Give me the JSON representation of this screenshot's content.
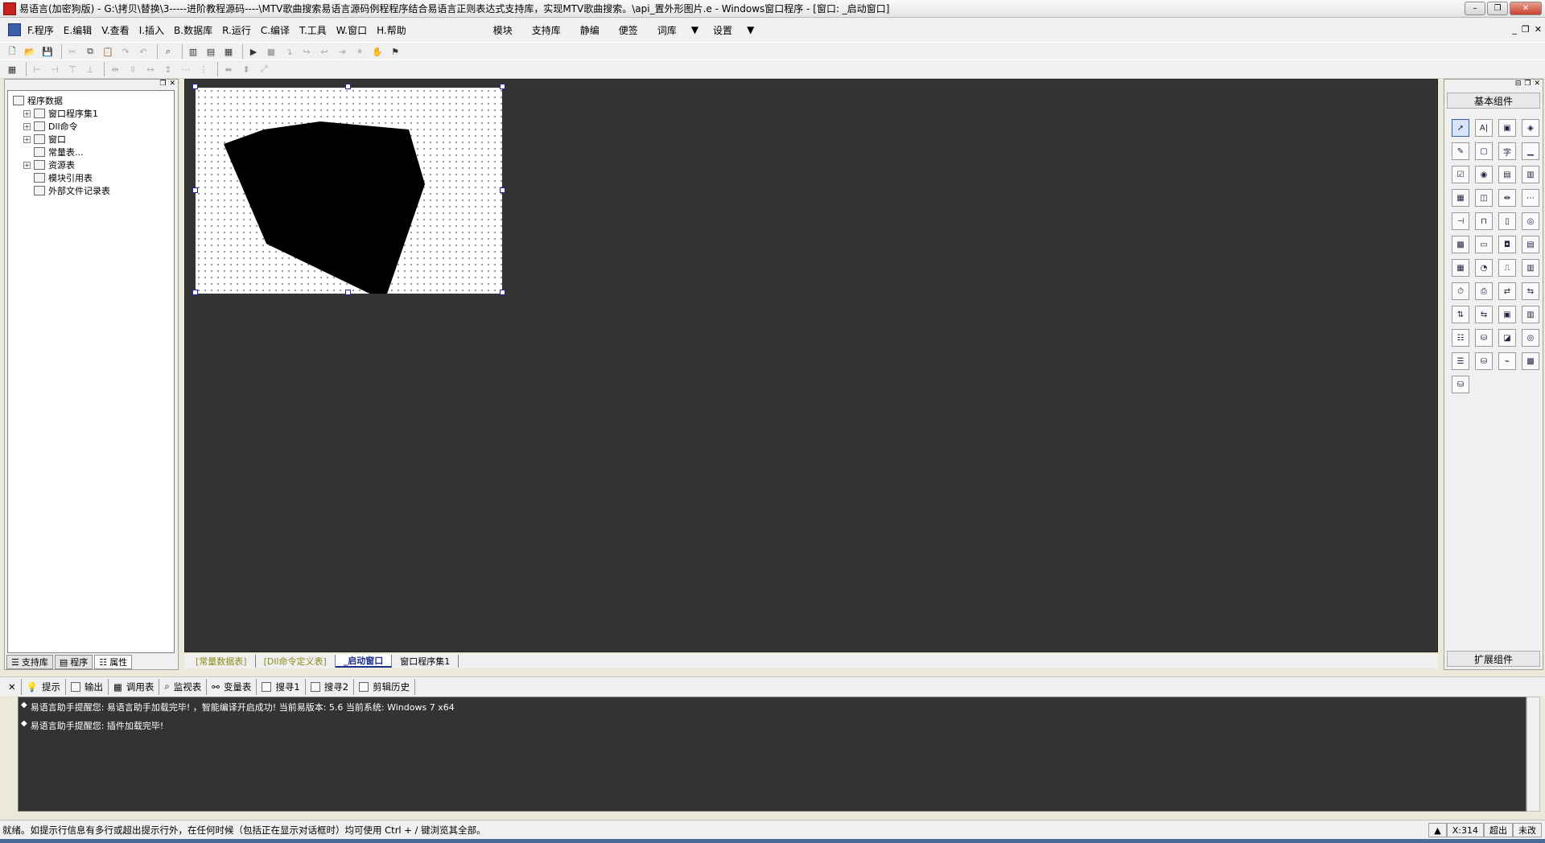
{
  "window": {
    "title": "易语言(加密狗版) - G:\\拷贝\\替换\\3-----进阶教程源码----\\MTV歌曲搜索易语言源码例程程序结合易语言正则表达式支持库，实现MTV歌曲搜索。\\api_置外形图片.e - Windows窗口程序 - [窗口: _启动窗口]"
  },
  "menu": {
    "items": [
      "F.程序",
      "E.编辑",
      "V.查看",
      "I.插入",
      "B.数据库",
      "R.运行",
      "C.编译",
      "T.工具",
      "W.窗口",
      "H.帮助"
    ],
    "right_items": [
      "模块",
      "支持库",
      "静编",
      "便签",
      "词库",
      "设置"
    ]
  },
  "left_panel": {
    "tree": [
      {
        "label": "程序数据",
        "level": 0
      },
      {
        "label": "窗口程序集1",
        "level": 1,
        "expandable": true
      },
      {
        "label": "Dll命令",
        "level": 1,
        "expandable": true
      },
      {
        "label": "窗口",
        "level": 1,
        "expandable": true
      },
      {
        "label": "常量表...",
        "level": 1,
        "expandable": false
      },
      {
        "label": "资源表",
        "level": 1,
        "expandable": true
      },
      {
        "label": "模块引用表",
        "level": 1,
        "expandable": false
      },
      {
        "label": "外部文件记录表",
        "level": 1,
        "expandable": false
      }
    ],
    "tabs": [
      "支持库",
      "程序",
      "属性"
    ]
  },
  "doc_tabs": [
    "[常量数据表]",
    "[Dll命令定义表]",
    "_启动窗口",
    "窗口程序集1"
  ],
  "right_panel": {
    "title": "基本组件",
    "footer": "扩展组件",
    "component_count": 45
  },
  "output": {
    "tabs": [
      "提示",
      "输出",
      "调用表",
      "监视表",
      "变量表",
      "搜寻1",
      "搜寻2",
      "剪辑历史"
    ],
    "lines": [
      "易语言助手提醒您: 易语言助手加载完毕! ，智能编译开启成功! 当前易版本: 5.6 当前系统: Windows 7 x64",
      "易语言助手提醒您: 插件加载完毕!"
    ]
  },
  "status": {
    "message": "就绪。如提示行信息有多行或超出提示行外，在任何时候（包括正在显示对话框时）均可使用 Ctrl + / 键浏览其全部。",
    "coord": "X:314",
    "mode": "超出",
    "state": "未改"
  },
  "colors": {
    "workspace_bg": "#333333",
    "active_tab": "#1b2f8a"
  }
}
